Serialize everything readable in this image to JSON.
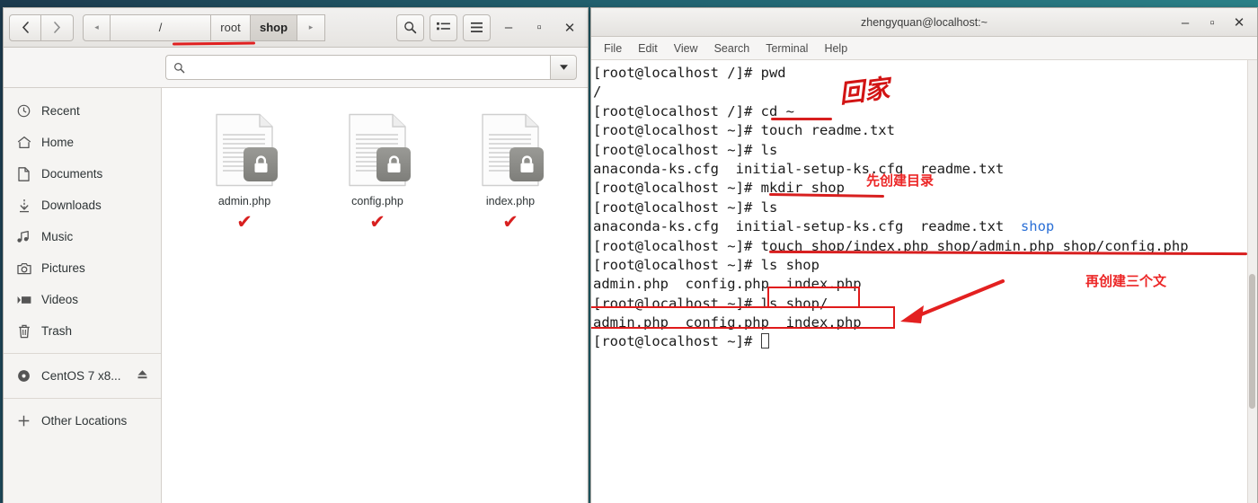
{
  "desktop": {
    "bg_color": "#21616f"
  },
  "file_manager": {
    "nav": {
      "back_icon": "‹",
      "forward_icon": "›"
    },
    "breadcrumb": {
      "left_arrow": "◂",
      "right_arrow": "▸",
      "items": [
        {
          "label": "/",
          "active": false
        },
        {
          "label": "root",
          "active": false
        },
        {
          "label": "shop",
          "active": true
        }
      ]
    },
    "toolbar": {
      "search_label": "search-icon",
      "list_view_label": "list-view-icon",
      "menu_label": "hamburger-menu-icon"
    },
    "window_controls": {
      "minimize": "–",
      "maximize": "▫",
      "close": "✕"
    },
    "search": {
      "value": "",
      "placeholder": ""
    },
    "sidebar": {
      "items": [
        {
          "label": "Recent",
          "icon": "clock-icon"
        },
        {
          "label": "Home",
          "icon": "home-icon"
        },
        {
          "label": "Documents",
          "icon": "document-icon"
        },
        {
          "label": "Downloads",
          "icon": "download-icon"
        },
        {
          "label": "Music",
          "icon": "music-icon"
        },
        {
          "label": "Pictures",
          "icon": "camera-icon"
        },
        {
          "label": "Videos",
          "icon": "video-icon"
        },
        {
          "label": "Trash",
          "icon": "trash-icon"
        }
      ],
      "devices": [
        {
          "label": "CentOS 7 x8...",
          "icon": "disc-icon",
          "eject": "⏏"
        }
      ],
      "other": {
        "label": "Other Locations",
        "icon": "plus-icon"
      }
    },
    "files": [
      {
        "name": "admin.php",
        "icon": "locked-document-icon",
        "check": "✔"
      },
      {
        "name": "config.php",
        "icon": "locked-document-icon",
        "check": "✔"
      },
      {
        "name": "index.php",
        "icon": "locked-document-icon",
        "check": "✔"
      }
    ]
  },
  "terminal": {
    "title": "zhengyquan@localhost:~",
    "window_controls": {
      "minimize": "–",
      "maximize": "▫",
      "close": "✕"
    },
    "menus": [
      "File",
      "Edit",
      "View",
      "Search",
      "Terminal",
      "Help"
    ],
    "lines": [
      {
        "text": "[root@localhost /]# pwd"
      },
      {
        "text": "/"
      },
      {
        "text": "[root@localhost /]# cd ~"
      },
      {
        "text": "[root@localhost ~]# touch readme.txt"
      },
      {
        "text": "[root@localhost ~]# ls"
      },
      {
        "text": "anaconda-ks.cfg  initial-setup-ks.cfg  readme.txt"
      },
      {
        "text": "[root@localhost ~]# mkdir shop"
      },
      {
        "text": "[root@localhost ~]# ls"
      },
      {
        "text": "anaconda-ks.cfg  initial-setup-ks.cfg  readme.txt  ",
        "dir": "shop"
      },
      {
        "text": "[root@localhost ~]# touch shop/index.php shop/admin.php shop/config.php"
      },
      {
        "text": "[root@localhost ~]# ls shop"
      },
      {
        "text": "admin.php  config.php  index.php"
      },
      {
        "text": "[root@localhost ~]# ls shop/"
      },
      {
        "text": "admin.php  config.php  index.php"
      },
      {
        "text": "[root@localhost ~]# ",
        "cursor": true
      }
    ],
    "annotations": [
      {
        "text": "回家",
        "note": "go-home"
      },
      {
        "text": "先创建目录",
        "note": "first-create-directory"
      },
      {
        "text": "再创建三个文",
        "note": "then-create-three-files"
      }
    ]
  }
}
